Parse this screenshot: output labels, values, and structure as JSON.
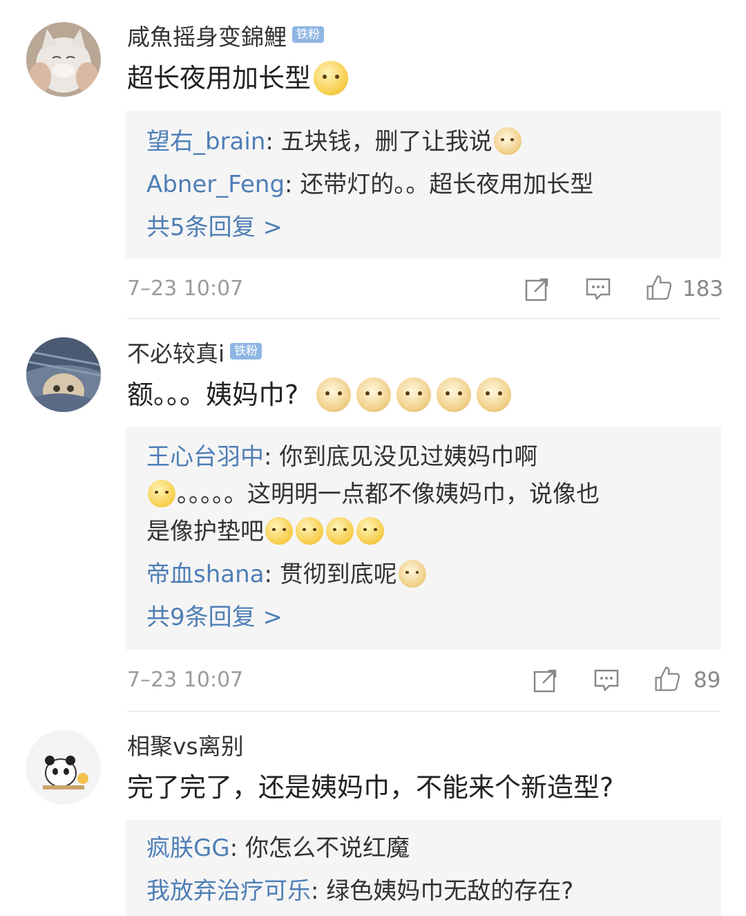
{
  "comments": [
    {
      "username": "咸魚摇身变錦鯉",
      "badge": "铁粉",
      "text": "超长夜用加长型",
      "replies": [
        {
          "name": "望右_brain",
          "text": "五块钱，删了让我说"
        },
        {
          "name": "Abner_Feng",
          "text": "还带灯的。。超长夜用加长型"
        }
      ],
      "more": "共5条回复 >",
      "time": "7–23 10:07",
      "likes": "183"
    },
    {
      "username": "不必较真i",
      "badge": "铁粉",
      "text": "额。。。姨妈巾?",
      "replies": [
        {
          "name": "王心台羽中",
          "text": "你到底见没见过姨妈巾啊"
        },
        {
          "name": "",
          "text": "。。。。。这明明一点都不像姨妈巾，说像也"
        },
        {
          "name": "",
          "text": "是像护垫吧"
        },
        {
          "name": "帝血shana",
          "text": "贯彻到底呢"
        }
      ],
      "more": "共9条回复 >",
      "time": "7–23 10:07",
      "likes": "89"
    },
    {
      "username": "相聚vs离别",
      "text": "完了完了，还是姨妈巾，不能来个新造型?",
      "replies": [
        {
          "name": "疯朕GG",
          "text": "你怎么不说红魔"
        },
        {
          "name": "我放弃治疗可乐",
          "text": "绿色姨妈巾无敌的存在?"
        }
      ]
    }
  ],
  "icons": {
    "share": "share-icon",
    "reply": "comment-icon",
    "like": "thumbs-up-icon"
  },
  "colors": {
    "link": "#4e7eb6",
    "badge": "#8fb6e3",
    "reply_bg": "#f5f5f5"
  }
}
